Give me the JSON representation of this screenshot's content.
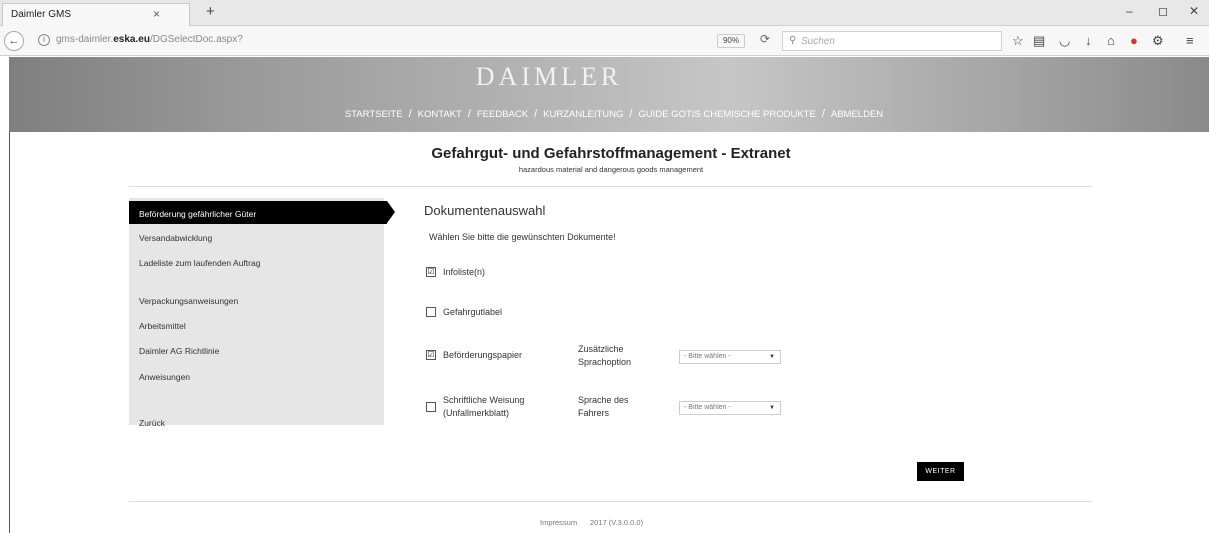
{
  "browser": {
    "tab_title": "Daimler GMS",
    "tab_close": "×",
    "new_tab": "+",
    "url_prefix": "gms-daimler.",
    "url_host": "eska.eu",
    "url_path": "/DGSelectDoc.aspx?",
    "zoom": "90%",
    "search_placeholder": "Suchen",
    "window_controls": [
      "–",
      "◻",
      "✕"
    ]
  },
  "header": {
    "brand": "DAIMLER",
    "nav": [
      "STARTSEITE",
      "KONTAKT",
      "FEEDBACK",
      "KURZANLEITUNG",
      "GUIDE GOTIS CHEMISCHE PRODUKTE",
      "ABMELDEN"
    ],
    "separator": "/"
  },
  "page": {
    "title": "Gefahrgut- und Gefahrstoffmanagement - Extranet",
    "subtitle": "hazardous material and dangerous goods management"
  },
  "sidebar": {
    "items": [
      {
        "label": "Beförderung gefährlicher Güter",
        "active": true
      },
      {
        "label": "Versandabwicklung"
      },
      {
        "label": "Ladeliste zum laufenden Auftrag"
      },
      {
        "label": "Verpackungsanweisungen"
      },
      {
        "label": "Arbeitsmittel"
      },
      {
        "label": "Daimler AG Richtlinie"
      },
      {
        "label": "Anweisungen"
      },
      {
        "label": "Zurück"
      }
    ]
  },
  "main": {
    "heading": "Dokumentenauswahl",
    "instruction": "Wählen Sie bitte die gewünschten Dokumente!",
    "documents": [
      {
        "label": "Infoliste(n)",
        "checked": true
      },
      {
        "label": "Gefahrgutlabel",
        "checked": false
      },
      {
        "label": "Beförderungspapier",
        "checked": true,
        "option_label": "Zusätzliche Sprachoption",
        "select_value": "- Bitte wählen -"
      },
      {
        "label": "Schriftliche Weisung (Unfallmerkblatt)",
        "checked": false,
        "option_label": "Sprache des Fahrers",
        "select_value": "- Bitte wählen -"
      }
    ],
    "check_glyph": "☑",
    "submit": "WEITER"
  },
  "footer": {
    "impressum": "Impressum",
    "version": "2017 (V.3.0.0.0)"
  }
}
